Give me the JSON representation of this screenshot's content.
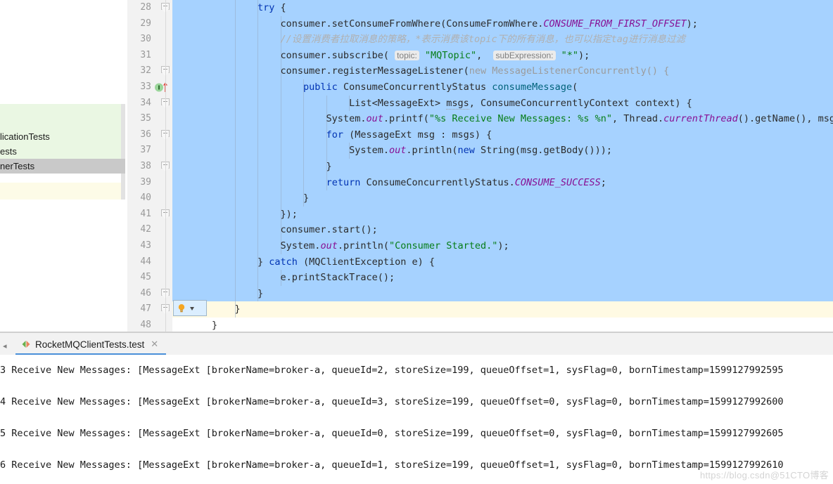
{
  "editor": {
    "first_line_number": 28,
    "lines": [
      {
        "n": 28,
        "fold": true,
        "marker": null,
        "selected": true,
        "segments": [
          {
            "t": "        ",
            "c": "id"
          },
          {
            "t": "try",
            "c": "kw"
          },
          {
            "t": " {",
            "c": "id"
          }
        ]
      },
      {
        "n": 29,
        "fold": false,
        "marker": null,
        "selected": true,
        "segments": [
          {
            "t": "            consumer.setConsumeFromWhere(ConsumeFromWhere.",
            "c": "id"
          },
          {
            "t": "CONSUME_FROM_FIRST_OFFSET",
            "c": "stat"
          },
          {
            "t": ");",
            "c": "id"
          }
        ]
      },
      {
        "n": 30,
        "fold": false,
        "marker": null,
        "selected": true,
        "segments": [
          {
            "t": "            ",
            "c": "id"
          },
          {
            "t": "//设置消费者拉取消息的策略，*表示消费该topic下的所有消息，也可以指定tag进行消息过滤",
            "c": "cmt"
          }
        ]
      },
      {
        "n": 31,
        "fold": false,
        "marker": null,
        "selected": true,
        "segments": [
          {
            "t": "            consumer.subscribe( ",
            "c": "id"
          },
          {
            "t": "topic:",
            "c": "hint"
          },
          {
            "t": " ",
            "c": "id"
          },
          {
            "t": "\"MQTopic\"",
            "c": "str"
          },
          {
            "t": ",  ",
            "c": "id"
          },
          {
            "t": "subExpression:",
            "c": "hint"
          },
          {
            "t": " ",
            "c": "id"
          },
          {
            "t": "\"*\"",
            "c": "str"
          },
          {
            "t": ");",
            "c": "id"
          }
        ]
      },
      {
        "n": 32,
        "fold": true,
        "marker": null,
        "selected": true,
        "segments": [
          {
            "t": "            consumer.registerMessageListener(",
            "c": "id"
          },
          {
            "t": "new",
            "c": "anon"
          },
          {
            "t": " MessageListenerConcurrently() {",
            "c": "anon"
          }
        ]
      },
      {
        "n": 33,
        "fold": false,
        "marker": "override",
        "selected": true,
        "segments": [
          {
            "t": "                ",
            "c": "id"
          },
          {
            "t": "public",
            "c": "kw"
          },
          {
            "t": " ConsumeConcurrentlyStatus ",
            "c": "id"
          },
          {
            "t": "consumeMessage",
            "c": "meth"
          },
          {
            "t": "(",
            "c": "id"
          }
        ]
      },
      {
        "n": 34,
        "fold": true,
        "marker": null,
        "selected": true,
        "segments": [
          {
            "t": "                        List<MessageExt> ",
            "c": "id"
          },
          {
            "t": "msgs",
            "c": "wavy"
          },
          {
            "t": ", ConsumeConcurrentlyContext context) {",
            "c": "id"
          }
        ]
      },
      {
        "n": 35,
        "fold": false,
        "marker": null,
        "selected": true,
        "segments": [
          {
            "t": "                    System.",
            "c": "id"
          },
          {
            "t": "out",
            "c": "fld"
          },
          {
            "t": ".printf(",
            "c": "id"
          },
          {
            "t": "\"%s Receive New Messages: %s %n\"",
            "c": "str"
          },
          {
            "t": ", Thread.",
            "c": "id"
          },
          {
            "t": "currentThread",
            "c": "fld"
          },
          {
            "t": "().getName(), msg",
            "c": "id"
          }
        ]
      },
      {
        "n": 36,
        "fold": true,
        "marker": null,
        "selected": true,
        "segments": [
          {
            "t": "                    ",
            "c": "id"
          },
          {
            "t": "for",
            "c": "kw"
          },
          {
            "t": " (MessageExt msg : msgs) {",
            "c": "id"
          }
        ]
      },
      {
        "n": 37,
        "fold": false,
        "marker": null,
        "selected": true,
        "segments": [
          {
            "t": "                        System.",
            "c": "id"
          },
          {
            "t": "out",
            "c": "fld"
          },
          {
            "t": ".println(",
            "c": "id"
          },
          {
            "t": "new",
            "c": "kw"
          },
          {
            "t": " String(msg.getBody()));",
            "c": "id"
          }
        ]
      },
      {
        "n": 38,
        "fold": true,
        "marker": null,
        "selected": true,
        "segments": [
          {
            "t": "                    }",
            "c": "id"
          }
        ]
      },
      {
        "n": 39,
        "fold": false,
        "marker": null,
        "selected": true,
        "segments": [
          {
            "t": "                    ",
            "c": "id"
          },
          {
            "t": "return",
            "c": "kw"
          },
          {
            "t": " ConsumeConcurrentlyStatus.",
            "c": "id"
          },
          {
            "t": "CONSUME_SUCCESS",
            "c": "stat"
          },
          {
            "t": ";",
            "c": "id"
          }
        ]
      },
      {
        "n": 40,
        "fold": false,
        "marker": null,
        "selected": true,
        "segments": [
          {
            "t": "                }",
            "c": "id"
          }
        ]
      },
      {
        "n": 41,
        "fold": true,
        "marker": null,
        "selected": true,
        "segments": [
          {
            "t": "            });",
            "c": "id"
          }
        ]
      },
      {
        "n": 42,
        "fold": false,
        "marker": null,
        "selected": true,
        "segments": [
          {
            "t": "            consumer.start();",
            "c": "id"
          }
        ]
      },
      {
        "n": 43,
        "fold": false,
        "marker": null,
        "selected": true,
        "segments": [
          {
            "t": "            System.",
            "c": "id"
          },
          {
            "t": "out",
            "c": "fld"
          },
          {
            "t": ".println(",
            "c": "id"
          },
          {
            "t": "\"Consumer Started.\"",
            "c": "str"
          },
          {
            "t": ");",
            "c": "id"
          }
        ]
      },
      {
        "n": 44,
        "fold": false,
        "marker": null,
        "selected": true,
        "segments": [
          {
            "t": "        } ",
            "c": "id"
          },
          {
            "t": "catch",
            "c": "kw"
          },
          {
            "t": " (MQClientException e) {",
            "c": "id"
          }
        ]
      },
      {
        "n": 45,
        "fold": false,
        "marker": null,
        "selected": true,
        "segments": [
          {
            "t": "            e.printStackTrace();",
            "c": "id"
          }
        ]
      },
      {
        "n": 46,
        "fold": true,
        "marker": null,
        "selected": true,
        "segments": [
          {
            "t": "        }",
            "c": "id"
          }
        ]
      },
      {
        "n": 47,
        "fold": true,
        "marker": null,
        "selected": false,
        "caret": true,
        "segments": [
          {
            "t": "    }",
            "c": "id"
          }
        ]
      },
      {
        "n": 48,
        "fold": false,
        "marker": null,
        "selected": false,
        "segments": [
          {
            "t": "}",
            "c": "id"
          }
        ]
      }
    ],
    "intention_widget": {
      "bulb_icon": "lightbulb-icon",
      "arrow_icon": "chevron-down-icon"
    }
  },
  "popup": {
    "items": [
      {
        "label": "licationTests",
        "selected": false
      },
      {
        "label": "ests",
        "selected": false
      },
      {
        "label": "nerTests",
        "selected": true
      }
    ]
  },
  "tabbar": {
    "overflow_icon": "chevron-left-icon",
    "tab": {
      "run_icon": "run-test-icon",
      "label": "RocketMQClientTests.test",
      "close_icon": "close-icon"
    }
  },
  "console": {
    "lines": [
      "3 Receive New Messages: [MessageExt [brokerName=broker-a, queueId=2, storeSize=199, queueOffset=1, sysFlag=0, bornTimestamp=1599127992595",
      "4 Receive New Messages: [MessageExt [brokerName=broker-a, queueId=3, storeSize=199, queueOffset=0, sysFlag=0, bornTimestamp=1599127992600",
      "5 Receive New Messages: [MessageExt [brokerName=broker-a, queueId=0, storeSize=199, queueOffset=0, sysFlag=0, bornTimestamp=1599127992605",
      "6 Receive New Messages: [MessageExt [brokerName=broker-a, queueId=1, storeSize=199, queueOffset=1, sysFlag=0, bornTimestamp=1599127992610"
    ]
  },
  "watermark": {
    "text": "https://blog.csdn@51CTO博客"
  },
  "colors": {
    "selection": "#a6d2ff",
    "caret_line": "#fffae3",
    "gutter": "#f2f2f2",
    "tab_accent": "#4a90d9",
    "popup_green": "#eaf7e3",
    "popup_selected": "#c9c9c9",
    "string": "#067d17",
    "keyword": "#0033b3",
    "static_field": "#871094",
    "comment": "#b0b0b0"
  }
}
